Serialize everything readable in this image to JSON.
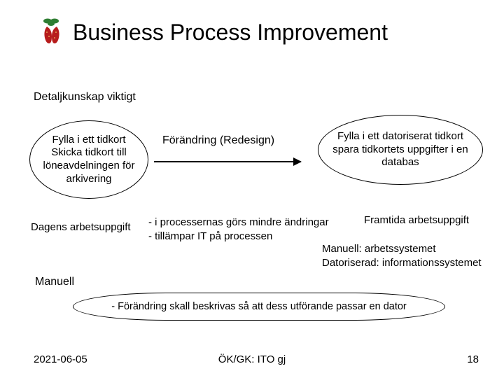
{
  "title": "Business Process Improvement",
  "subtitle": "Detaljkunskap viktigt",
  "ellipse_left": "Fylla i ett tidkort Skicka tidkort till löneavdelningen för arkivering",
  "redesign_label": "Förändring (Redesign)",
  "ellipse_right": "Fylla i ett datoriserat tidkort spara tidkortets uppgifter i en databas",
  "dagens": "Dagens arbetsuppgift",
  "bullet1": "- i processernas görs mindre ändringar",
  "bullet2": "- tillämpar IT  på processen",
  "framtida": "Framtida arbetsuppgift",
  "manuell_line1": "Manuell: arbetssystemet",
  "manuell_line2": "Datoriserad: informationssystemet",
  "manuell": "Manuell",
  "wide_ellipse": "- Förändring skall beskrivas så att dess utförande passar en dator",
  "footer": {
    "date": "2021-06-05",
    "center": "ÖK/GK: ITO gj",
    "page": "18"
  },
  "logo_name": "strawberry-icon"
}
